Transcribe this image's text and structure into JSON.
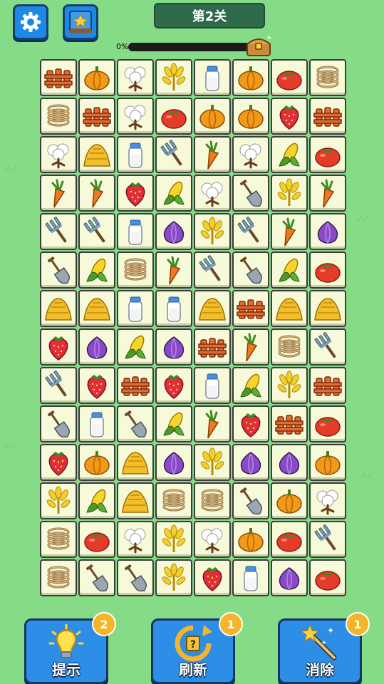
{
  "level": {
    "title": "第2关"
  },
  "progress": {
    "percent_text": "0%",
    "value": 0
  },
  "board": {
    "rows": [
      [
        "fence",
        "pumpkin",
        "cotton",
        "wheat",
        "milk",
        "pumpkin",
        "tomato",
        "rope"
      ],
      [
        "rope",
        "fence",
        "cotton",
        "tomato",
        "pumpkin",
        "pumpkin",
        "strawberry",
        "fence"
      ],
      [
        "cotton",
        "hay",
        "milk",
        "fork",
        "carrot",
        "cotton",
        "corn",
        "tomato"
      ],
      [
        "carrot",
        "carrot",
        "strawberry",
        "corn",
        "cotton",
        "shovel",
        "wheat",
        "carrot"
      ],
      [
        "fork",
        "fork",
        "milk",
        "onion",
        "wheat",
        "fork",
        "carrot",
        "onion"
      ],
      [
        "shovel",
        "corn",
        "rope",
        "carrot",
        "fork",
        "shovel",
        "corn",
        "tomato"
      ],
      [
        "hay",
        "hay",
        "milk",
        "milk",
        "hay",
        "fence",
        "hay",
        "hay"
      ],
      [
        "strawberry",
        "onion",
        "corn",
        "onion",
        "fence",
        "carrot",
        "rope",
        "fork"
      ],
      [
        "fork",
        "strawberry",
        "fence",
        "strawberry",
        "milk",
        "corn",
        "wheat",
        "fence"
      ],
      [
        "shovel",
        "milk",
        "shovel",
        "corn",
        "carrot",
        "strawberry",
        "fence",
        "tomato"
      ],
      [
        "strawberry",
        "pumpkin",
        "hay",
        "onion",
        "wheat",
        "onion",
        "onion",
        "pumpkin"
      ],
      [
        "wheat",
        "corn",
        "hay",
        "rope",
        "rope",
        "shovel",
        "pumpkin",
        "cotton"
      ],
      [
        "rope",
        "tomato",
        "cotton",
        "wheat",
        "cotton",
        "pumpkin",
        "tomato",
        "fork"
      ],
      [
        "rope",
        "shovel",
        "shovel",
        "wheat",
        "strawberry",
        "milk",
        "onion",
        "tomato"
      ]
    ]
  },
  "tools": [
    {
      "label": "提示",
      "count": "2",
      "icon": "lightbulb-icon"
    },
    {
      "label": "刷新",
      "count": "1",
      "icon": "refresh-icon"
    },
    {
      "label": "消除",
      "count": "1",
      "icon": "magic-wand-icon"
    }
  ],
  "colors": {
    "background": "#86dc86",
    "tile": "#f7fad8",
    "button": "#2d8ee8",
    "badge": "#f4b52a"
  }
}
